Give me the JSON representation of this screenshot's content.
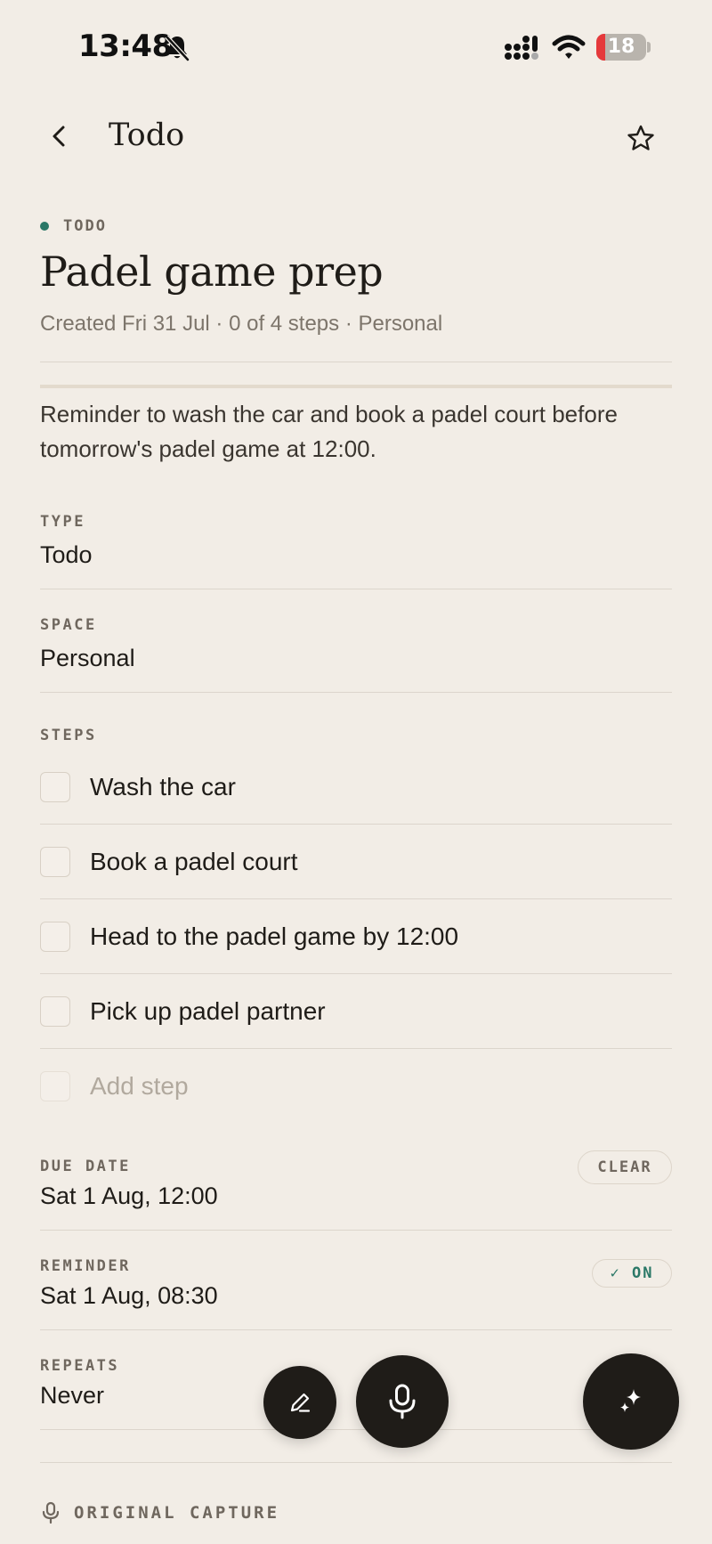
{
  "status_bar": {
    "time": "13:48",
    "battery": "18",
    "battery_level": 0.18
  },
  "header": {
    "title": "Todo",
    "back_icon": "chevron-left-icon",
    "favorite_icon": "star-icon"
  },
  "item": {
    "kind": "TODO",
    "kind_color": "#2b7867",
    "title": "Padel game prep",
    "meta": "Created Fri 31 Jul · 0 of 4 steps · Personal",
    "description": "Reminder to wash the car and book a padel court before tomorrow's padel game at 12:00."
  },
  "fields": {
    "type": {
      "label": "TYPE",
      "value": "Todo"
    },
    "space": {
      "label": "SPACE",
      "value": "Personal"
    }
  },
  "steps": {
    "label": "STEPS",
    "items": [
      {
        "label": "Wash the car",
        "checked": false
      },
      {
        "label": "Book a padel court",
        "checked": false
      },
      {
        "label": "Head to the padel game by 12:00",
        "checked": false
      },
      {
        "label": "Pick up padel partner",
        "checked": false
      }
    ],
    "add_placeholder": "Add step"
  },
  "schedule": {
    "due_date": {
      "label": "DUE DATE",
      "value": "Sat 1 Aug, 12:00",
      "action": "CLEAR"
    },
    "reminder": {
      "label": "REMINDER",
      "value": "Sat 1 Aug, 08:30",
      "toggle": "ON"
    },
    "repeats": {
      "label": "REPEATS",
      "value": "Never"
    }
  },
  "original_capture": {
    "label": "ORIGINAL CAPTURE",
    "icon": "microphone-icon"
  },
  "fabs": {
    "edit_icon": "pencil-icon",
    "mic_icon": "microphone-icon",
    "ai_icon": "sparkle-icon"
  }
}
